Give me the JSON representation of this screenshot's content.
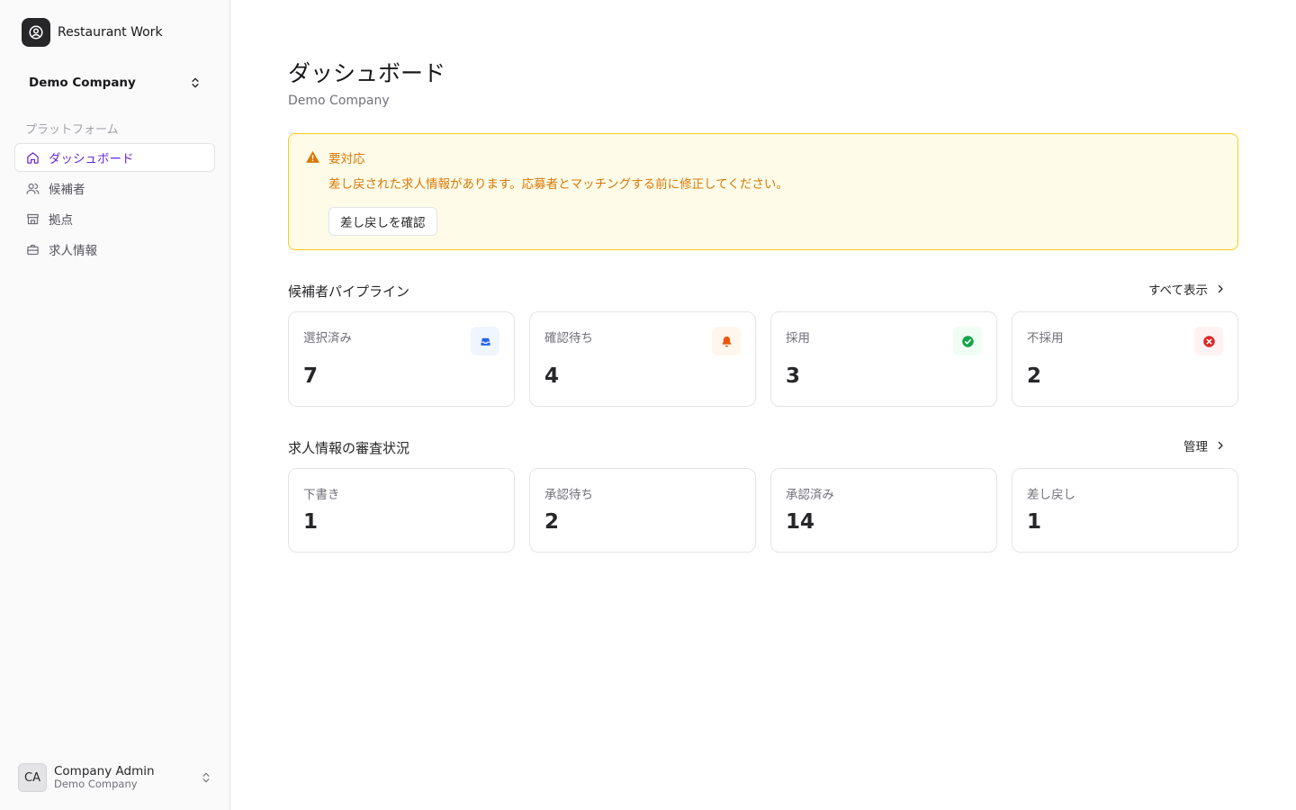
{
  "sidebar": {
    "brand": "Restaurant Work",
    "company_switcher": "Demo Company",
    "section_label": "プラットフォーム",
    "items": [
      {
        "label": "ダッシュボード",
        "icon": "home-icon",
        "active": true
      },
      {
        "label": "候補者",
        "icon": "users-icon"
      },
      {
        "label": "拠点",
        "icon": "store-icon"
      },
      {
        "label": "求人情報",
        "icon": "briefcase-icon"
      }
    ],
    "user": {
      "initials": "CA",
      "name": "Company Admin",
      "company": "Demo Company"
    }
  },
  "header": {
    "title": "ダッシュボード",
    "subtitle": "Demo Company"
  },
  "alert": {
    "title": "要対応",
    "message": "差し戻された求人情報があります。応募者とマッチングする前に修正してください。",
    "button": "差し戻しを確認",
    "color": "#d97706"
  },
  "pipeline": {
    "title": "候補者パイプライン",
    "link": "すべて表示",
    "cards": [
      {
        "label": "選択済み",
        "value": "7",
        "icon": "inbox-icon",
        "color": "#2563eb"
      },
      {
        "label": "確認待ち",
        "value": "4",
        "icon": "bell-icon",
        "color": "#ea580c"
      },
      {
        "label": "採用",
        "value": "3",
        "icon": "check-circle-icon",
        "color": "#16a34a"
      },
      {
        "label": "不採用",
        "value": "2",
        "icon": "x-circle-icon",
        "color": "#dc2626"
      }
    ]
  },
  "review": {
    "title": "求人情報の審査状況",
    "link": "管理",
    "cards": [
      {
        "label": "下書き",
        "value": "1"
      },
      {
        "label": "承認待ち",
        "value": "2"
      },
      {
        "label": "承認済み",
        "value": "14"
      },
      {
        "label": "差し戻し",
        "value": "1"
      }
    ]
  }
}
